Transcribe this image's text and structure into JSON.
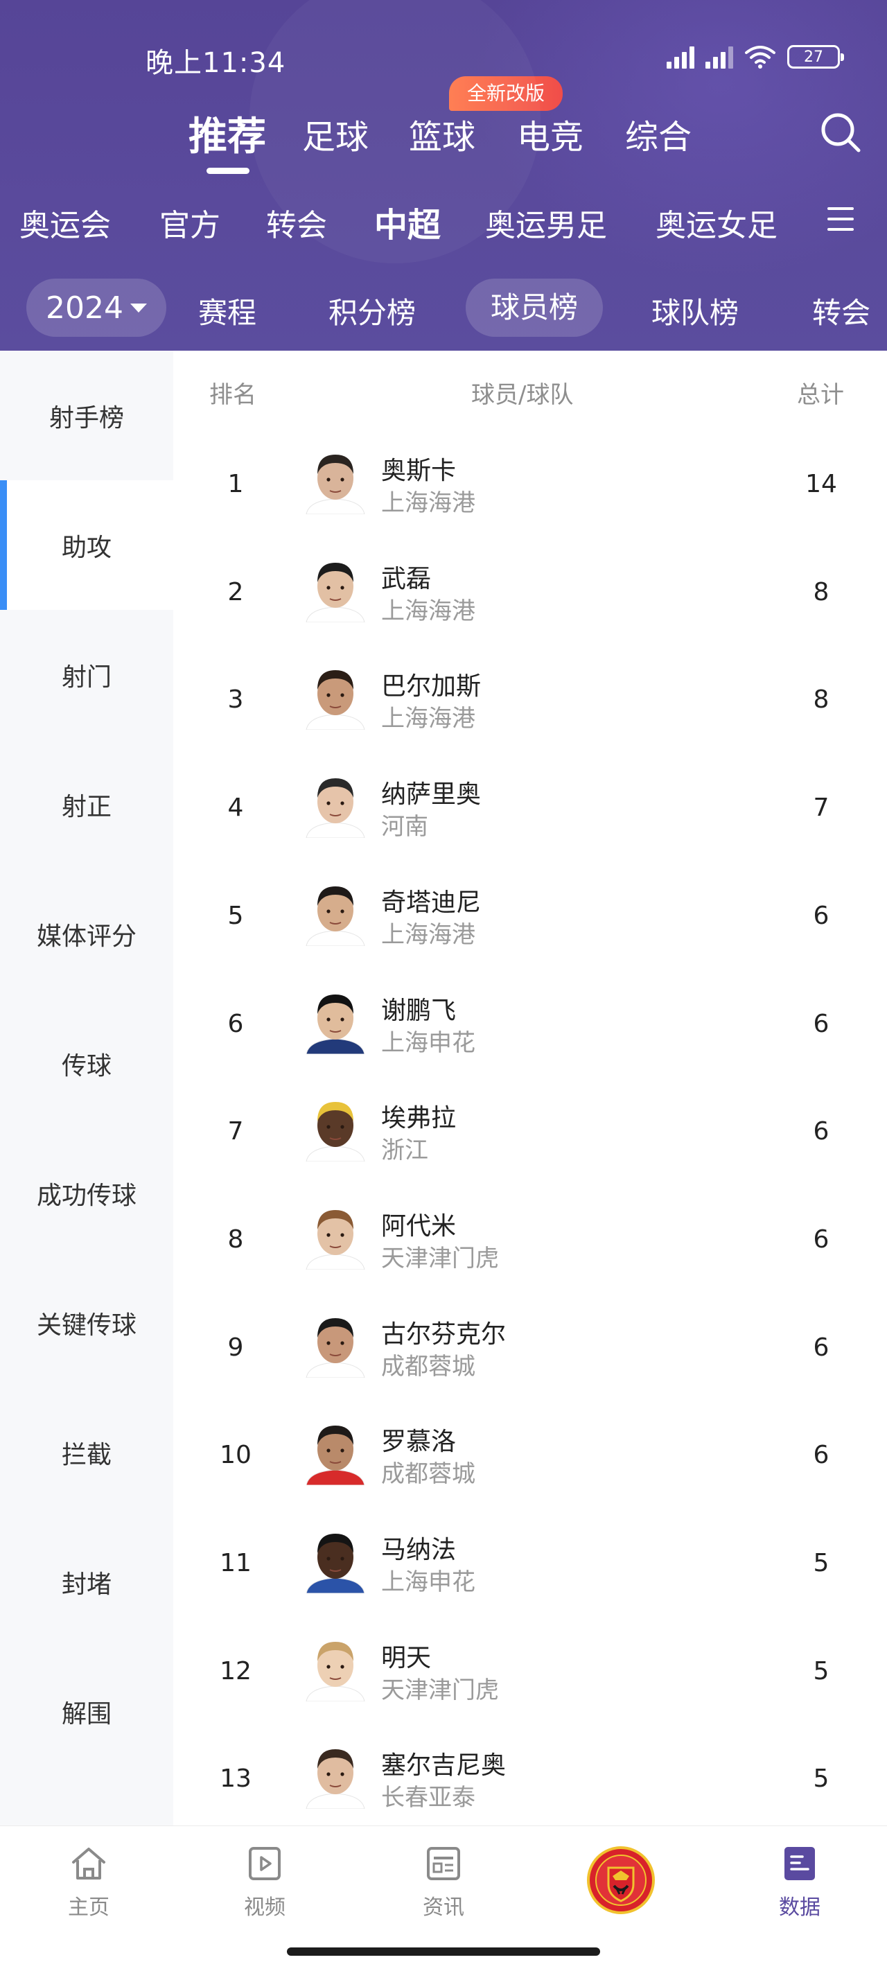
{
  "status_bar": {
    "time": "晚上11:34",
    "battery": "27"
  },
  "main_tabs": [
    {
      "label": "推荐",
      "active": true
    },
    {
      "label": "足球"
    },
    {
      "label": "篮球"
    },
    {
      "label": "电竞"
    },
    {
      "label": "综合"
    }
  ],
  "new_badge": "全新改版",
  "competition_tabs": [
    {
      "label": "奥运会"
    },
    {
      "label": "官方"
    },
    {
      "label": "转会"
    },
    {
      "label": "中超",
      "active": true
    },
    {
      "label": "奥运男足"
    },
    {
      "label": "奥运女足"
    }
  ],
  "sub_tabs": {
    "year": "2024",
    "items": [
      {
        "label": "赛程"
      },
      {
        "label": "积分榜"
      },
      {
        "label": "球员榜",
        "active": true
      },
      {
        "label": "球队榜"
      },
      {
        "label": "转会"
      }
    ]
  },
  "categories": [
    {
      "label": "射手榜"
    },
    {
      "label": "助攻",
      "active": true
    },
    {
      "label": "射门"
    },
    {
      "label": "射正"
    },
    {
      "label": "媒体评分"
    },
    {
      "label": "传球"
    },
    {
      "label": "成功传球"
    },
    {
      "label": "关键传球"
    },
    {
      "label": "拦截"
    },
    {
      "label": "封堵"
    },
    {
      "label": "解围"
    }
  ],
  "table": {
    "headers": {
      "rank": "排名",
      "player": "球员/球队",
      "total": "总计"
    },
    "rows": [
      {
        "rank": "1",
        "name": "奥斯卡",
        "team": "上海海港",
        "total": "14"
      },
      {
        "rank": "2",
        "name": "武磊",
        "team": "上海海港",
        "total": "8"
      },
      {
        "rank": "3",
        "name": "巴尔加斯",
        "team": "上海海港",
        "total": "8"
      },
      {
        "rank": "4",
        "name": "纳萨里奥",
        "team": "河南",
        "total": "7"
      },
      {
        "rank": "5",
        "name": "奇塔迪尼",
        "team": "上海海港",
        "total": "6"
      },
      {
        "rank": "6",
        "name": "谢鹏飞",
        "team": "上海申花",
        "total": "6"
      },
      {
        "rank": "7",
        "name": "埃弗拉",
        "team": "浙江",
        "total": "6"
      },
      {
        "rank": "8",
        "name": "阿代米",
        "team": "天津津门虎",
        "total": "6"
      },
      {
        "rank": "9",
        "name": "古尔芬克尔",
        "team": "成都蓉城",
        "total": "6"
      },
      {
        "rank": "10",
        "name": "罗慕洛",
        "team": "成都蓉城",
        "total": "6"
      },
      {
        "rank": "11",
        "name": "马纳法",
        "team": "上海申花",
        "total": "5"
      },
      {
        "rank": "12",
        "name": "明天",
        "team": "天津津门虎",
        "total": "5"
      },
      {
        "rank": "13",
        "name": "塞尔吉尼奥",
        "team": "长春亚泰",
        "total": "5"
      }
    ]
  },
  "bottom_nav": [
    {
      "label": "主页",
      "icon": "home-icon"
    },
    {
      "label": "视频",
      "icon": "video-icon"
    },
    {
      "label": "资讯",
      "icon": "news-icon"
    },
    {
      "label": "",
      "icon": "club-crest-icon"
    },
    {
      "label": "数据",
      "icon": "data-icon",
      "active": true
    }
  ],
  "colors": {
    "header_bg": "#564597",
    "active_accent": "#3a8ef6",
    "badge": "#f04d4a",
    "nav_active": "#5a4aa0"
  }
}
